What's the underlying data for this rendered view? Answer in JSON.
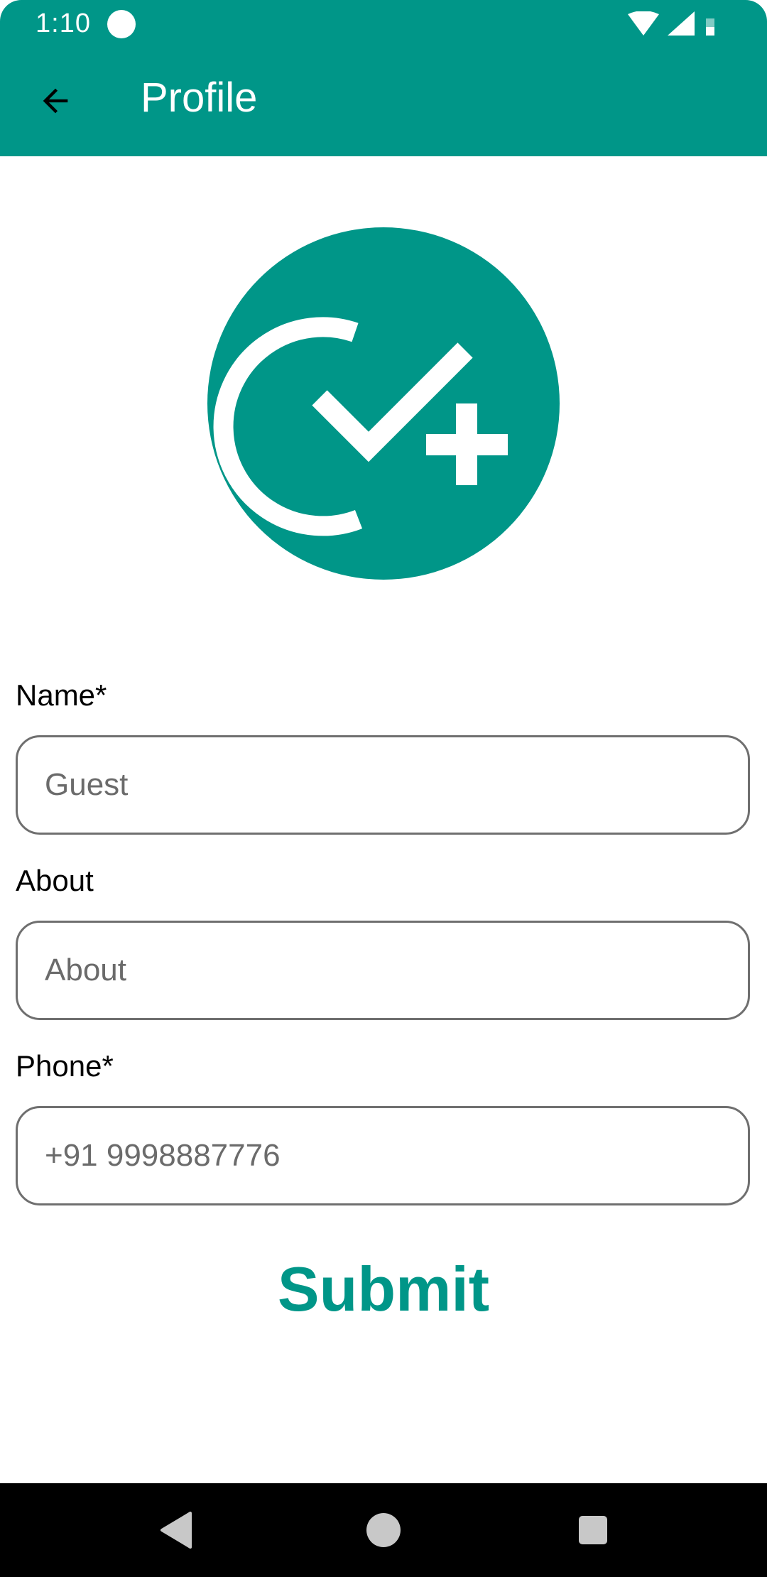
{
  "status_bar": {
    "time": "1:10",
    "icons": [
      "record-dot-icon",
      "wifi-icon",
      "signal-icon",
      "battery-icon"
    ]
  },
  "app_bar": {
    "title": "Profile",
    "back_icon": "arrow-left-icon"
  },
  "logo": {
    "icon": "check-plus-logo",
    "background_color": "#009688",
    "foreground_color": "#ffffff"
  },
  "form": {
    "name": {
      "label": "Name*",
      "placeholder": "Guest",
      "value": ""
    },
    "about": {
      "label": "About",
      "placeholder": "About",
      "value": ""
    },
    "phone": {
      "label": "Phone*",
      "placeholder": "+91 9998887776",
      "value": ""
    },
    "submit_label": "Submit"
  },
  "nav_bar": {
    "buttons": [
      "back-triangle-icon",
      "home-circle-icon",
      "recents-square-icon"
    ]
  },
  "colors": {
    "primary": "#009688",
    "text": "#000000",
    "field_border": "#6f6f6f",
    "placeholder": "#6b6b6b",
    "nav_background": "#000000"
  }
}
